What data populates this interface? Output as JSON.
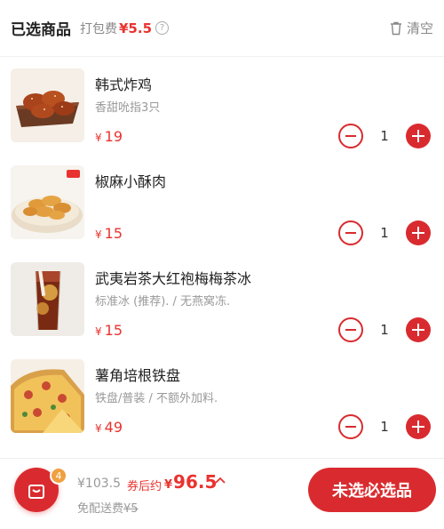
{
  "header": {
    "title": "已选商品",
    "packaging_fee_label": "打包费",
    "packaging_fee_value": "¥5.5",
    "help_icon": "question-circle-icon",
    "clear_label": "清空",
    "clear_icon": "trash-icon"
  },
  "items": [
    {
      "name": "韩式炸鸡",
      "desc": "香甜吮指3只",
      "currency": "¥",
      "price": "19",
      "qty": "1"
    },
    {
      "name": "椒麻小酥肉",
      "desc": "",
      "currency": "¥",
      "price": "15",
      "qty": "1"
    },
    {
      "name": "武夷岩茶大红袍梅梅茶冰",
      "desc": "标准冰 (推荐). / 无燕窝冻.",
      "currency": "¥",
      "price": "15",
      "qty": "1"
    },
    {
      "name": "薯角培根铁盘",
      "desc": "铁盘/普装 / 不额外加料.",
      "currency": "¥",
      "price": "49",
      "qty": "1"
    }
  ],
  "footer": {
    "cart_count": "4",
    "original_total": "¥103.5",
    "estimate_label": "券后约",
    "estimate_currency": "¥",
    "estimate_value": "96.5",
    "delivery_label": "免配送费",
    "delivery_original": "¥5",
    "checkout_label": "未选必选品"
  },
  "colors": {
    "accent": "#d92b2f",
    "price": "#e8332f",
    "badge": "#f0a040",
    "muted": "#999999"
  }
}
